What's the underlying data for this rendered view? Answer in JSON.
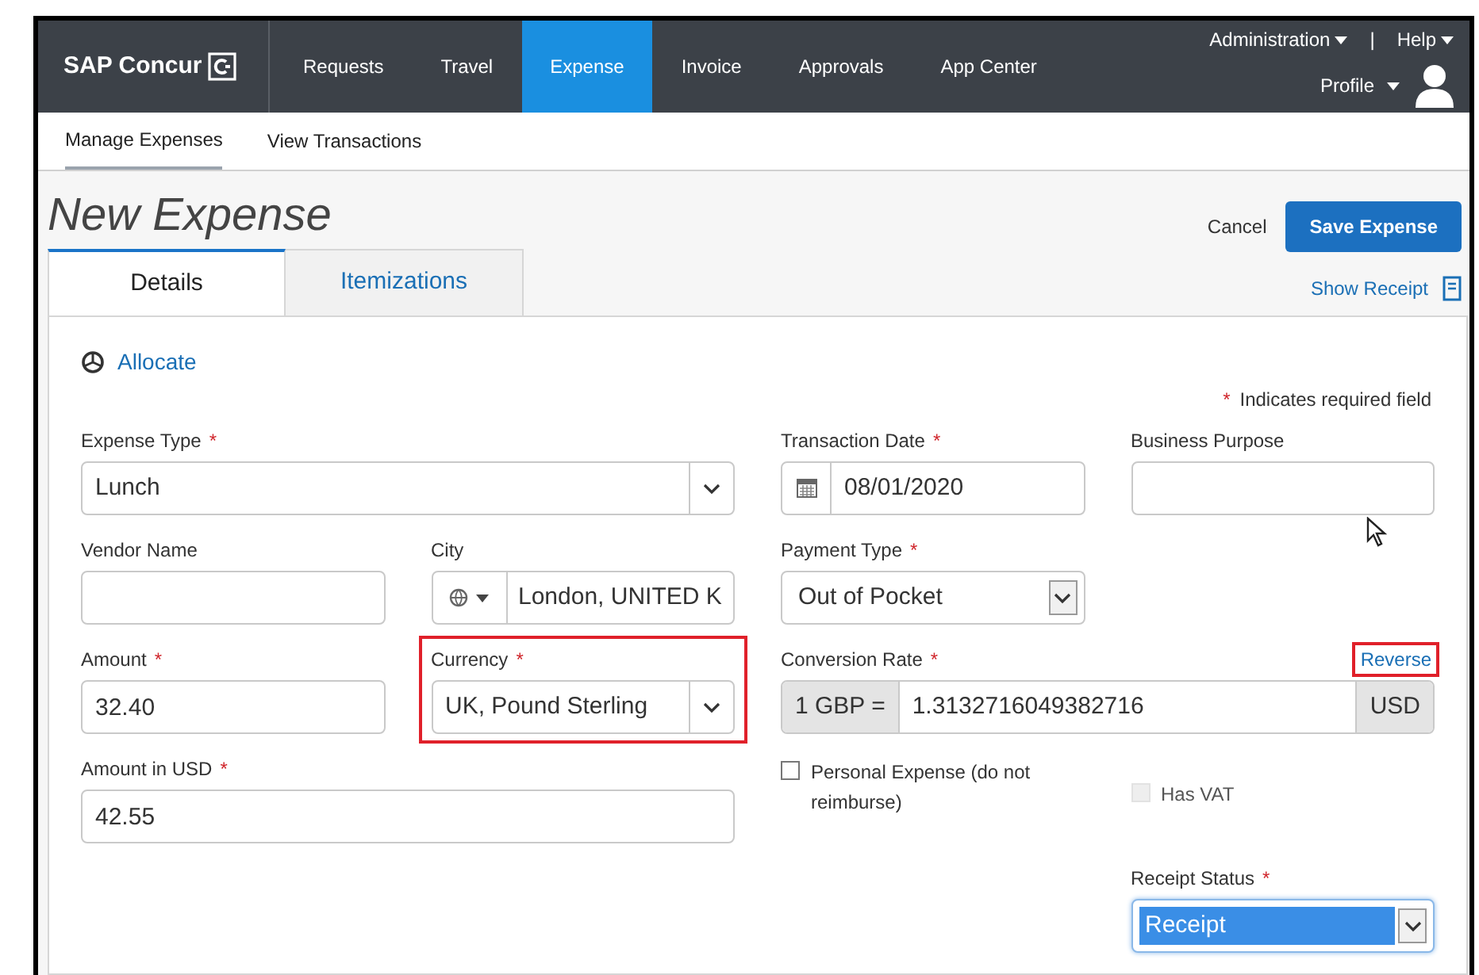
{
  "brand": {
    "label": "SAP Concur"
  },
  "nav": [
    {
      "label": "Requests",
      "selected": false
    },
    {
      "label": "Travel",
      "selected": false
    },
    {
      "label": "Expense",
      "selected": true
    },
    {
      "label": "Invoice",
      "selected": false
    },
    {
      "label": "Approvals",
      "selected": false
    },
    {
      "label": "App Center",
      "selected": false
    }
  ],
  "utility": {
    "items": [
      "Administration",
      "Help"
    ],
    "separator": "|"
  },
  "profile": {
    "label": "Profile"
  },
  "subnav": [
    {
      "label": "Manage Expenses",
      "selected": true
    },
    {
      "label": "View Transactions",
      "selected": false
    }
  ],
  "page_title": "New Expense",
  "actions": {
    "cancel": "Cancel",
    "save": "Save Expense"
  },
  "tabs": [
    {
      "label": "Details",
      "selected": true
    },
    {
      "label": "Itemizations",
      "selected": false
    }
  ],
  "show_receipt": "Show Receipt",
  "allocate": "Allocate",
  "required_note": {
    "mark": "*",
    "text": "Indicates required field"
  },
  "rows": [
    [
      {
        "kind": "select",
        "label": "Expense Type",
        "required_mark": "*",
        "value": "Lunch"
      },
      {
        "kind": "date",
        "label": "Transaction Date",
        "required_mark": "*",
        "value": "08/01/2020"
      },
      {
        "kind": "text",
        "label": "Business Purpose"
      }
    ],
    [
      {
        "kind": "text",
        "label": "Vendor Name"
      },
      {
        "kind": "location",
        "label": "City",
        "value": "London, UNITED K"
      },
      {
        "kind": "native_select",
        "label": "Payment Type",
        "required_mark": "*",
        "value": "Out of Pocket",
        "focused": false
      },
      null
    ],
    [
      {
        "kind": "text",
        "label": "Amount",
        "required_mark": "*",
        "value": "32.40"
      },
      {
        "kind": "select",
        "label": "Currency",
        "required_mark": "*",
        "value": "UK, Pound Sterling",
        "highlighted": true
      },
      {
        "kind": "rate",
        "label": "Conversion Rate",
        "required_mark": "*",
        "prefix": "1 GBP =",
        "value": "1.3132716049382716",
        "suffix": "USD",
        "link": {
          "label": "Reverse",
          "highlighted": true
        }
      }
    ],
    [
      {
        "kind": "text",
        "label": "Amount in USD",
        "required_mark": "*",
        "value": "42.55"
      },
      {
        "kind": "checkbox",
        "label": "Personal Expense (do not reimburse)",
        "checked": false,
        "disabled": false
      },
      {
        "kind": "checkbox",
        "label": "Has VAT",
        "checked": false,
        "disabled": true
      }
    ],
    [
      null,
      null,
      null,
      {
        "kind": "native_select",
        "label": "Receipt Status",
        "required_mark": "*",
        "value": "Receipt",
        "focused": true
      }
    ]
  ]
}
